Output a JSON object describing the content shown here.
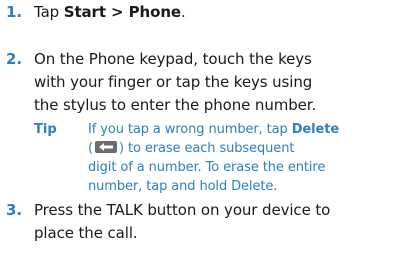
{
  "steps": [
    {
      "number": "1.",
      "text_plain": "Tap ",
      "bold_1": "Start > Phone",
      "text_end": "."
    },
    {
      "number": "2.",
      "line1": "On the Phone keypad, touch the keys",
      "line2": "with your finger or tap the keys using",
      "line3": "the stylus to enter the phone number."
    },
    {
      "number": "3.",
      "line1": "Press the TALK button on your device to",
      "line2": "place the call."
    }
  ],
  "tip": {
    "label": "Tip",
    "line1_a": "If you tap a wrong number, tap ",
    "line1_bold": "Delete",
    "line2_a": "(",
    "line2_b": ") to erase each subsequent",
    "line3": "digit of a number. To erase the entire",
    "line4": "number, tap and hold Delete.",
    "icon": "backspace-icon"
  }
}
